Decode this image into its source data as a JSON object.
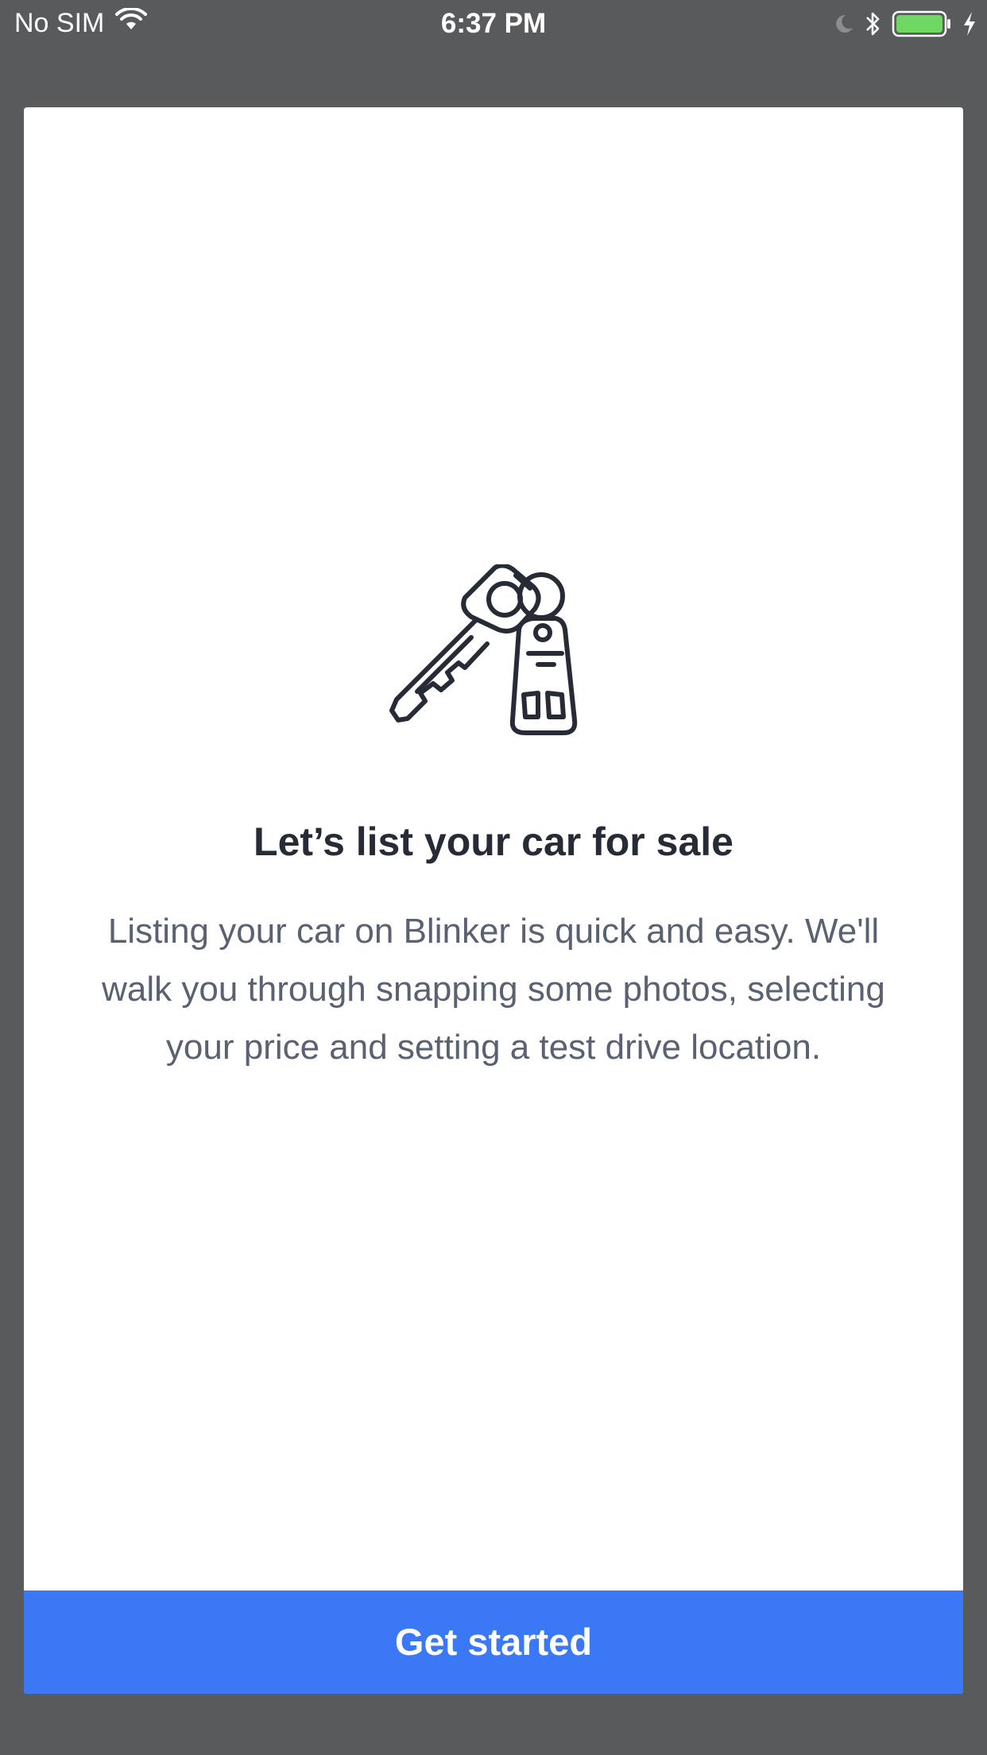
{
  "status_bar": {
    "carrier": "No SIM",
    "time": "6:37 PM",
    "icons": [
      "wifi-icon",
      "moon-icon",
      "bluetooth-icon",
      "battery-icon",
      "charging-icon"
    ],
    "battery_level": 1.0,
    "battery_color": "#6fd862"
  },
  "onboarding": {
    "illustration": "car-keys-icon",
    "title": "Let’s list your car for sale",
    "description": "Listing your car on Blinker is quick and easy. We'll walk you through snapping some photos, selecting your price and setting a test drive location.",
    "cta_label": "Get started"
  },
  "colors": {
    "background": "#595a5c",
    "card": "#ffffff",
    "accent": "#3b78f5",
    "title_text": "#262b36",
    "body_text": "#5a6170"
  }
}
